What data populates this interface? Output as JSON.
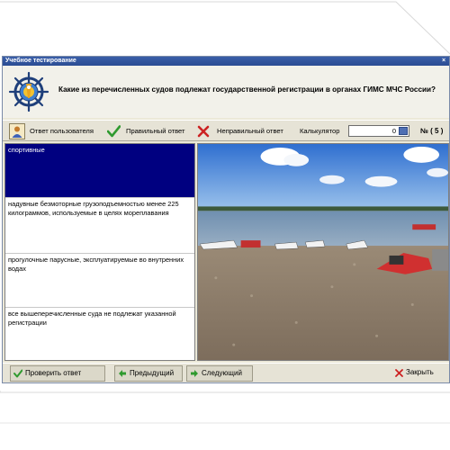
{
  "window": {
    "title": "Учебное тестирование",
    "close_glyph": "×"
  },
  "question": {
    "text": "Какие из перечисленных судов подлежат государственной регистрации в органах ГИМС МЧС России?"
  },
  "toolbar": {
    "user_answer_label": "Ответ пользователя",
    "correct_answer_label": "Правильный ответ",
    "wrong_answer_label": "Неправильный ответ",
    "calculator_label": "Калькулятор",
    "calculator_value": "0",
    "counter": "№ ( 5 )"
  },
  "answers": [
    {
      "text": "спортивные",
      "selected": true
    },
    {
      "text": "надувные безмоторные грузоподъемностью менее 225 килограммов, используемые в целях мореплавания",
      "selected": false
    },
    {
      "text": "прогулочные парусные, эксплуатируемые во внутренних водах",
      "selected": false
    },
    {
      "text": "все вышеперечисленные суда не подлежат указанной регистрации",
      "selected": false
    }
  ],
  "bottom": {
    "check_label": "Проверить ответ",
    "prev_label": "Предыдущий",
    "next_label": "Следующий",
    "close_label": "Закрыть"
  },
  "colors": {
    "title_bar": "#2b4c93",
    "selected_answer": "#000080",
    "accent_green": "#2f9a2f",
    "accent_red": "#cc2222"
  },
  "icons": [
    "ship-wheel-logo-icon",
    "user-icon",
    "check-icon",
    "cross-icon",
    "calculator-icon",
    "check-answer-icon",
    "arrow-left-icon",
    "arrow-right-icon",
    "close-icon"
  ]
}
